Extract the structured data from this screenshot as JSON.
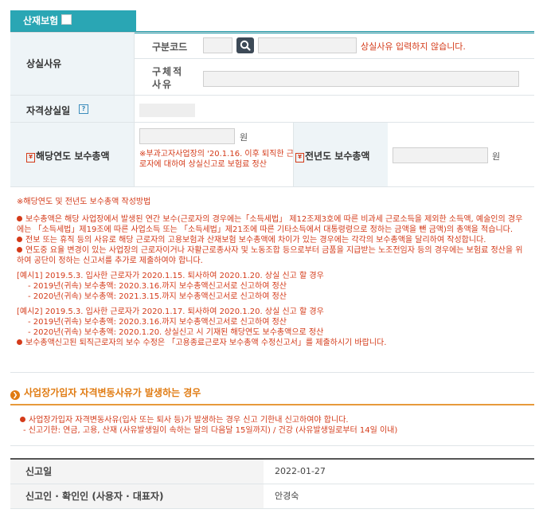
{
  "tab": {
    "label": "산재보험"
  },
  "loss_reason": {
    "label": "상실사유",
    "code_label": "구분코드",
    "code_warning": "상실사유 입력하지 않습니다.",
    "detail_label": "구체적 사유"
  },
  "qual_loss_date": {
    "label": "자격상실일",
    "help": "?"
  },
  "wages": {
    "current_label": "해당연도 보수총액",
    "current_unit": "원",
    "current_note": "※부과고자사업장의 '20.1.16. 이후 퇴직한 근로자에 대하여 상실신고로 보험료 정산",
    "prev_label": "전년도 보수총액",
    "prev_unit": "원",
    "req_mark": "¥"
  },
  "notice": {
    "title": "※해당연도 및 전년도 보수총액 작성방법",
    "b1": "보수총액은 해당 사업장에서 발생된 연간 보수(근로자의 경우에는「소득세법」 제12조제3호에 따른 비과세 근로소득을 제외한 소득액, 예술인의 경우에는 「소득세법」제19조에 따른 사업소득 또는 「소득세법」제21조에 따른 기타소득에서 대통령령으로 정하는 금액을 뺀 금액)의 총액을 적습니다.",
    "b2": "전보 또는 휴직 등의 사유로 해당 근로자의 고용보험과 산재보험 보수총액에 차이가 있는 경우에는 각각의 보수총액을 달리하여 작성합니다.",
    "b3": "연도중 요율 변경이 있는 사업장의 근로자이거나 자활근로종사자 및 노동조합 등으로부터 금품을 지급받는 노조전임자 등의 경우에는 보험료 정산을 위하여 공단이 정하는 신고서를 추가로 제출하여야 합니다.",
    "ex1": "[예시1] 2019.5.3. 입사한 근로자가 2020.1.15. 퇴사하여 2020.1.20. 상실 신고 할 경우",
    "ex1a": "- 2019년(귀속) 보수총액: 2020.3.16.까지 보수총액신고서로 신고하여 정산",
    "ex1b": "- 2020년(귀속) 보수총액: 2021.3.15.까지 보수총액신고서로 신고하여 정산",
    "ex2": "[예시2] 2019.5.3. 입사한 근로자가 2020.1.17. 퇴사하여 2020.1.20. 상실 신고 할 경우",
    "ex2a": "- 2019년(귀속) 보수총액: 2020.3.16.까지 보수총액신고서로 신고하여 정산",
    "ex2b": "- 2020년(귀속) 보수총액: 2020.1.20. 상실신고 시 기재된 해당연도 보수총액으로 정산",
    "b4": "보수총액신고된 퇴직근로자의 보수 수정은 「고용종료근로자 보수총액 수정신고서」를 제출하시기 바랍니다."
  },
  "section2": {
    "title": "사업장가입자 자격변동사유가 발생하는 경우",
    "line1": "사업장가입자 자격변동사유(입사 또는 퇴사 등)가 발생하는 경우 신고 기한내 신고하여야 합니다.",
    "line2": "- 신고기한: 연금, 고용, 산재 (사유발생일이 속하는 달의 다음달 15일까지) / 건강 (사유발생일로부터 14일 이내)"
  },
  "report": {
    "date_label": "신고일",
    "date_value": "2022-01-27",
    "reporter_label": "신고인 · 확인인 (사용자 · 대표자)",
    "reporter_value": "안경숙"
  }
}
